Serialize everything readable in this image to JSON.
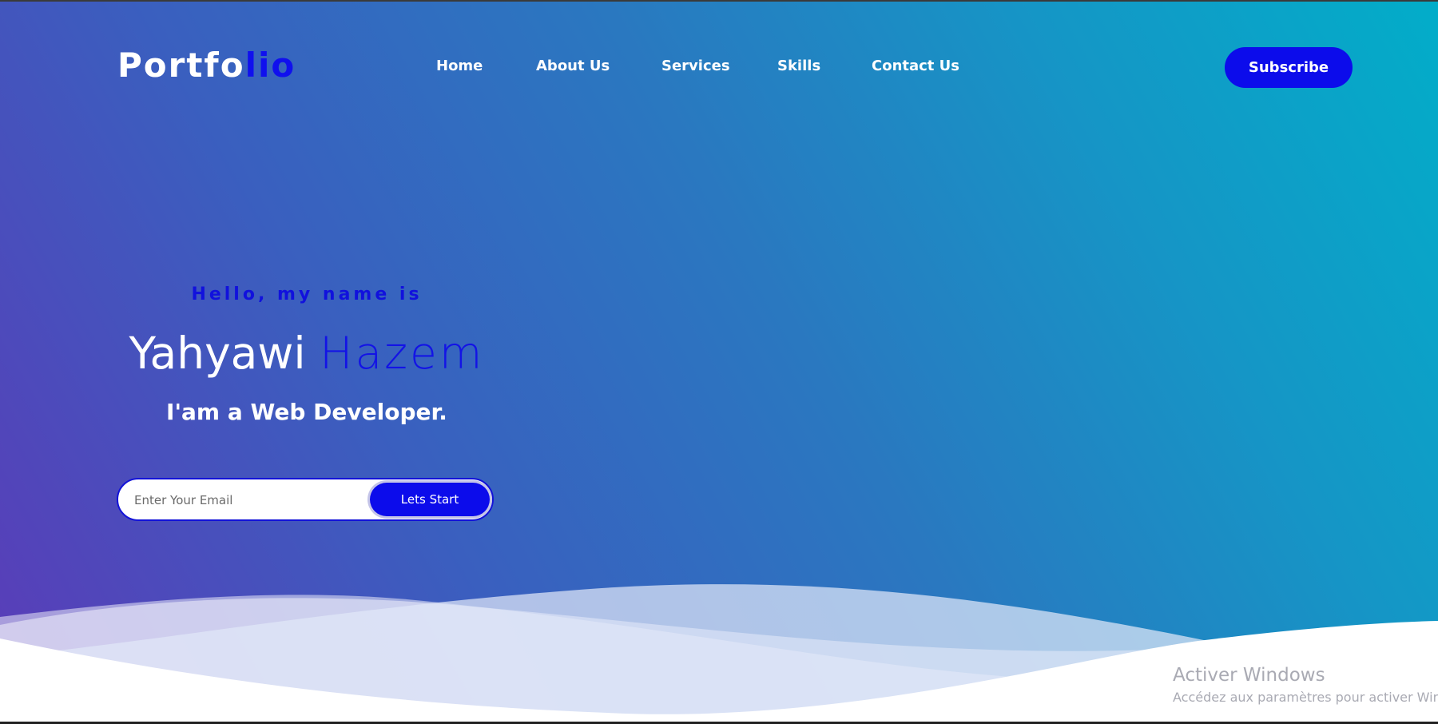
{
  "header": {
    "logo_main": "Portfo",
    "logo_accent": "lio",
    "nav": [
      "Home",
      "About Us",
      "Services",
      "Skills",
      "Contact Us"
    ],
    "subscribe_label": "Subscribe"
  },
  "hero": {
    "greeting": "Hello, my name is",
    "first_name": "Yahyawi",
    "last_name": "Hazem",
    "role": "I'am a Web Developer.",
    "email_placeholder": "Enter Your Email",
    "cta_label": "Lets Start"
  },
  "watermark": {
    "title": "Activer Windows",
    "subtitle": "Accédez aux paramètres pour activer Windows."
  },
  "colors": {
    "accent": "#0c0ceb",
    "gradient_start": "#5b3bb8",
    "gradient_end": "#02adc9"
  }
}
